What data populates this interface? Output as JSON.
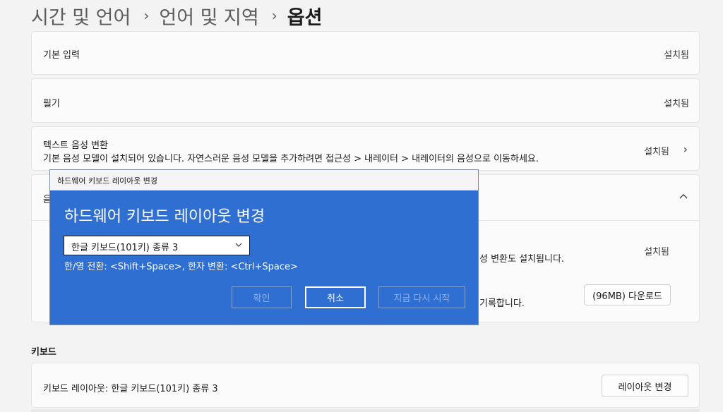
{
  "breadcrumb": {
    "items": [
      "시간 및 언어",
      "언어 및 지역"
    ],
    "current": "옵션",
    "separator": "›"
  },
  "features": [
    {
      "title": "기본 입력",
      "status": "설치됨"
    },
    {
      "title": "필기",
      "status": "설치됨"
    },
    {
      "title": "텍스트 음성 변환",
      "description": "기본 음성 모델이 설치되어 있습니다. 자연스러운 음성 모델을 추가하려면 접근성 > 내레이터 > 내레이터의 음성으로 이동하세요.",
      "status": "설치됨"
    }
  ],
  "speech": {
    "title_fragment": "음",
    "row1_text_fragment": "성 변환도 설치됩니다.",
    "row1_status": "설치됨",
    "row2_text_fragment": "기록합니다.",
    "download_button": "(96MB) 다운로드"
  },
  "keyboard_section": {
    "label": "키보드",
    "layout_text": "키보드 레이아웃: 한글 키보드(101키) 종류 3",
    "change_button": "레이아웃 변경"
  },
  "dialog": {
    "window_title": "하드웨어 키보드 레이아웃 변경",
    "heading": "하드웨어 키보드 레이아웃 변경",
    "selected_layout": "한글 키보드(101키) 종류 3",
    "info": "한/영 전환: <Shift+Space>, 한자 변환: <Ctrl+Space>",
    "buttons": {
      "confirm": "확인",
      "cancel": "취소",
      "restart": "지금 다시 시작"
    }
  },
  "colors": {
    "dialog_bg": "#2f6fd1",
    "page_bg": "#f3f3f3",
    "card_bg": "#fbfbfb"
  }
}
